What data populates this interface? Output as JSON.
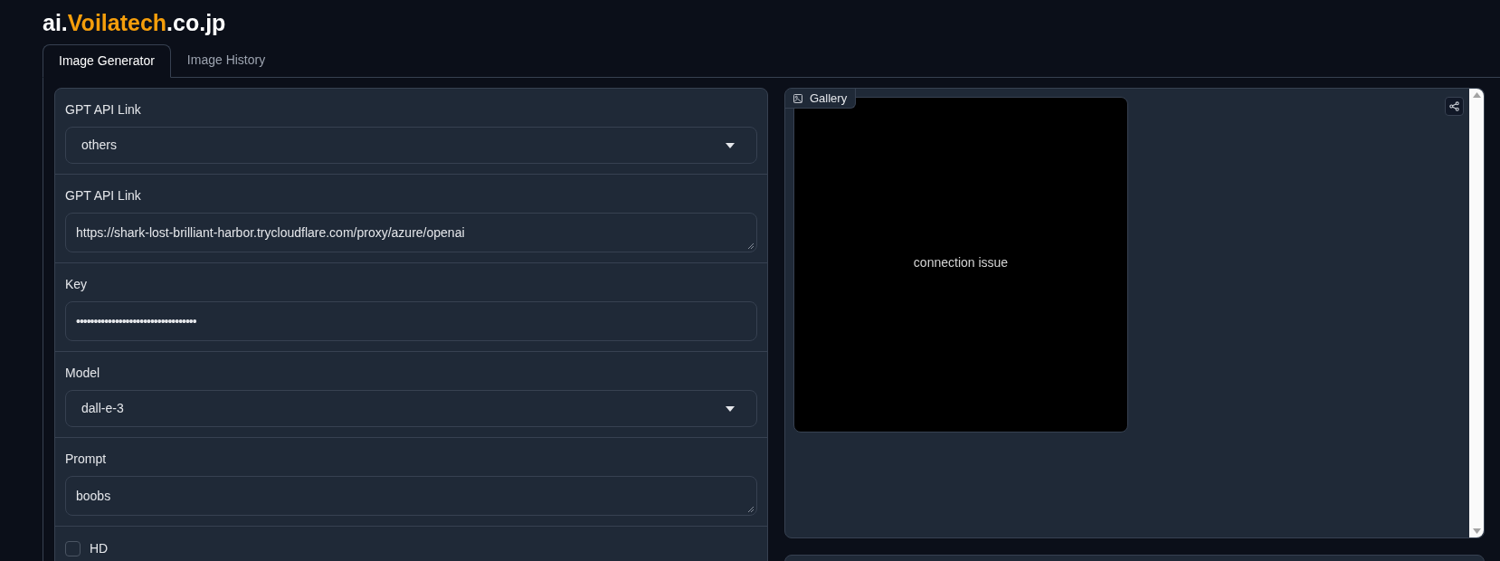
{
  "logo": {
    "prefix": "ai.",
    "highlight": "Voilatech",
    "suffix": ".co.jp"
  },
  "tabs": [
    {
      "label": "Image Generator",
      "selected": true
    },
    {
      "label": "Image History",
      "selected": false
    }
  ],
  "form": [
    {
      "kind": "dropdown",
      "label": "GPT API Link",
      "value": "others"
    },
    {
      "kind": "textarea",
      "label": "GPT API Link",
      "value": "https://shark-lost-brilliant-harbor.trycloudflare.com/proxy/azure/openai"
    },
    {
      "kind": "password",
      "label": "Key",
      "value": "••••••••••••••••••••••••••••••••••"
    },
    {
      "kind": "dropdown",
      "label": "Model",
      "value": "dall-e-3"
    },
    {
      "kind": "textarea",
      "label": "Prompt",
      "value": "boobs"
    },
    {
      "kind": "checkbox",
      "label": "HD",
      "checked": false
    }
  ],
  "gallery": {
    "label": "Gallery",
    "images": [
      {
        "text": "connection issue"
      }
    ]
  }
}
